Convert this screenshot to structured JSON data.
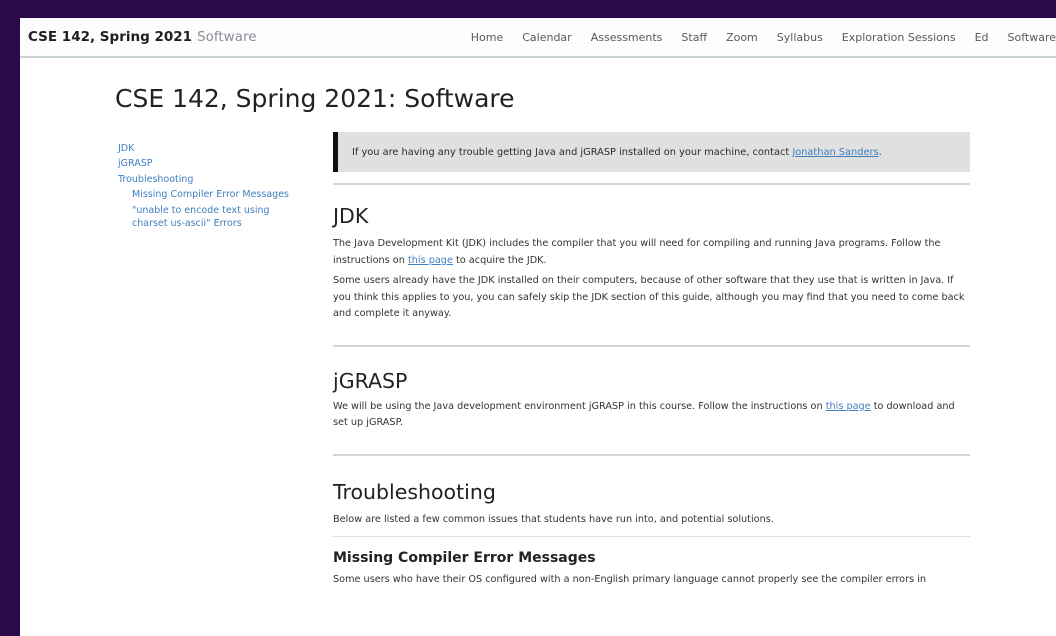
{
  "navbar": {
    "brand": "CSE 142, Spring 2021",
    "brand_sub": "Software",
    "links": [
      "Home",
      "Calendar",
      "Assessments",
      "Staff",
      "Zoom",
      "Syllabus",
      "Exploration Sessions",
      "Ed",
      "Software"
    ]
  },
  "page": {
    "title": "CSE 142, Spring 2021: Software"
  },
  "toc": {
    "items": [
      "JDK",
      "jGRASP",
      "Troubleshooting"
    ],
    "sub_items": [
      "Missing Compiler Error Messages",
      "\"unable to encode text using charset us-ascii\" Errors"
    ]
  },
  "callout": {
    "text_before": "If you are having any trouble getting Java and jGRASP installed on your machine, contact ",
    "link": "Jonathan Sanders",
    "text_after": "."
  },
  "jdk": {
    "heading": "JDK",
    "p1_before": "The Java Development Kit (JDK) includes the compiler that you will need for compiling and running Java programs. Follow the instructions on ",
    "p1_link": "this page",
    "p1_after": " to acquire the JDK.",
    "p2": "Some users already have the JDK installed on their computers, because of other software that they use that is written in Java. If you think this applies to you, you can safely skip the JDK section of this guide, although you may find that you need to come back and complete it anyway."
  },
  "jgrasp": {
    "heading": "jGRASP",
    "p1_before": "We will be using the Java development environment jGRASP in this course. Follow the instructions on ",
    "p1_link": "this page",
    "p1_after": " to download and set up jGRASP."
  },
  "troubleshooting": {
    "heading": "Troubleshooting",
    "p1": "Below are listed a few common issues that students have run into, and potential solutions."
  },
  "missing_compiler": {
    "heading": "Missing Compiler Error Messages",
    "p1": "Some users who have their OS configured with a non-English primary language cannot properly see the compiler errors in"
  }
}
